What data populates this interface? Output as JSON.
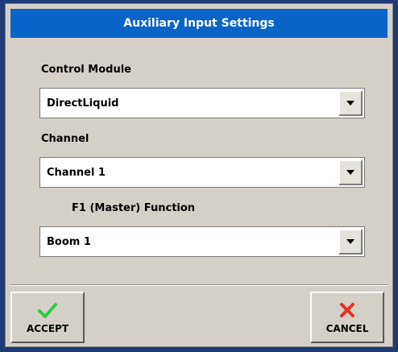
{
  "dialog": {
    "title": "Auxiliary Input Settings"
  },
  "fields": [
    {
      "label": "Control Module",
      "value": "DirectLiquid"
    },
    {
      "label": "Channel",
      "value": "Channel 1"
    },
    {
      "label": "F1 (Master) Function",
      "value": "Boom 1"
    }
  ],
  "buttons": {
    "accept_label": "ACCEPT",
    "cancel_label": "CANCEL"
  },
  "icons": {
    "accept": "checkmark-icon",
    "cancel": "x-icon",
    "dropdown": "dropdown-arrow-icon"
  },
  "colors": {
    "frame": "#1f3a74",
    "titlebar": "#0a64c8",
    "panel": "#d4d0c8",
    "accept_icon": "#2ecc40",
    "cancel_icon": "#e8321e"
  }
}
